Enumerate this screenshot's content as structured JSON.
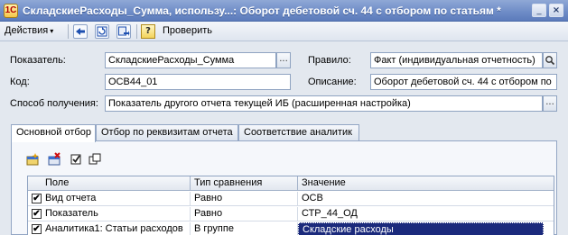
{
  "window": {
    "title": "СкладскиеРасходы_Сумма, использу...: Оборот дебетовой сч. 44 с отбором по статьям *",
    "app_icon_glyph": "1С",
    "minimize_glyph": "_",
    "close_glyph": "×"
  },
  "toolbar": {
    "actions_label": "Действия",
    "actions_arrow": "▾",
    "verify_label": "Проверить",
    "help_glyph": "?",
    "icons": [
      "nav-back-icon",
      "refresh-icon",
      "settings-arrow-icon",
      "help-icon"
    ]
  },
  "form": {
    "indicator_label": "Показатель:",
    "indicator_value": "СкладскиеРасходы_Сумма",
    "rule_label": "Правило:",
    "rule_value": "Факт (индивидуальная отчетность)",
    "code_label": "Код:",
    "code_value": "ОСВ44_01",
    "description_label": "Описание:",
    "description_value": "Оборот дебетовой сч. 44 с отбором по",
    "method_label": "Способ получения:",
    "method_value": "Показатель другого отчета текущей ИБ (расширенная настройка)",
    "select_glyph": "...",
    "search_glyph": "🔍"
  },
  "tabs": [
    {
      "label": "Основной отбор",
      "active": true
    },
    {
      "label": "Отбор по реквизитам отчета",
      "active": false
    },
    {
      "label": "Соответствие аналитик",
      "active": false
    }
  ],
  "grid": {
    "columns": [
      "Поле",
      "Тип сравнения",
      "Значение"
    ],
    "rows": [
      {
        "checked": true,
        "field": "Вид отчета",
        "comparison": "Равно",
        "value": "ОСВ"
      },
      {
        "checked": true,
        "field": "Показатель",
        "comparison": "Равно",
        "value": "СТР_44_ОД"
      },
      {
        "checked": true,
        "field": "Аналитика1: Статьи расходов",
        "comparison": "В группе",
        "value": "Складские расходы"
      }
    ],
    "check_glyph": "✔"
  },
  "colors": {
    "titlebar": "#6d8bc6",
    "selection": "#1b2a7c",
    "background": "#e3e8ef"
  }
}
